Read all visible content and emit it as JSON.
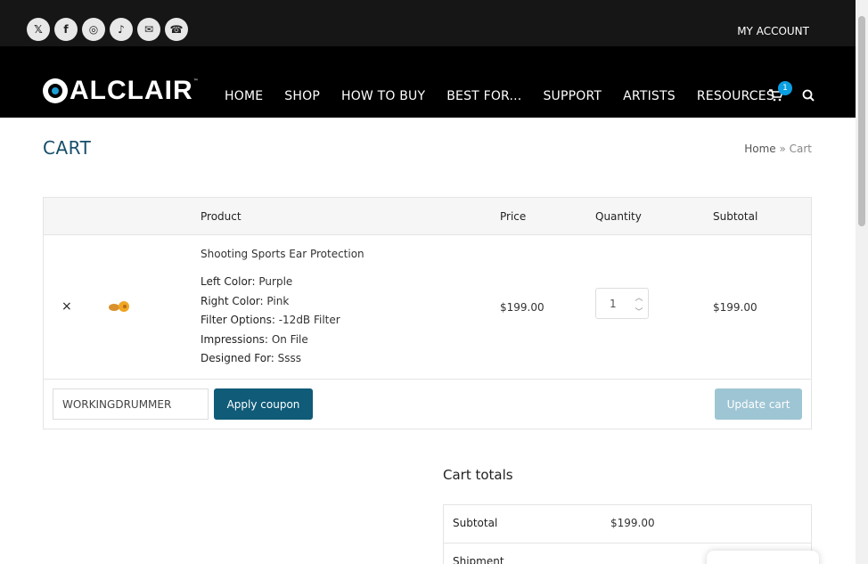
{
  "topbar": {
    "social": [
      "X",
      "Facebook",
      "Instagram",
      "TikTok",
      "Email",
      "Phone"
    ],
    "my_account": "MY ACCOUNT"
  },
  "nav": {
    "logo": "ALCLAIR",
    "items": [
      "HOME",
      "SHOP",
      "HOW TO BUY",
      "BEST FOR...",
      "SUPPORT",
      "ARTISTS",
      "RESOURCES"
    ],
    "cart_count": "1"
  },
  "page": {
    "title": "CART",
    "breadcrumb_home": "Home",
    "breadcrumb_sep": " » ",
    "breadcrumb_current": "Cart"
  },
  "table": {
    "headers": {
      "product": "Product",
      "price": "Price",
      "quantity": "Quantity",
      "subtotal": "Subtotal"
    },
    "item": {
      "remove": "×",
      "name": "Shooting Sports Ear Protection",
      "meta": [
        {
          "label": "Left Color:",
          "value": "Purple"
        },
        {
          "label": "Right Color:",
          "value": "Pink"
        },
        {
          "label": "Filter Options:",
          "value": "-12dB Filter"
        },
        {
          "label": "Impressions:",
          "value": "On File"
        },
        {
          "label": "Designed For:",
          "value": "Ssss"
        }
      ],
      "price": "$199.00",
      "quantity": "1",
      "subtotal": "$199.00"
    },
    "coupon_value": "WORKINGDRUMMER",
    "apply_label": "Apply coupon",
    "update_label": "Update cart"
  },
  "totals": {
    "title": "Cart totals",
    "subtotal_label": "Subtotal",
    "subtotal_value": "$199.00",
    "shipment_label": "Shipment"
  },
  "colors": {
    "accent": "#0f5b78",
    "title": "#164e6a",
    "badge": "#0a9fe3"
  }
}
